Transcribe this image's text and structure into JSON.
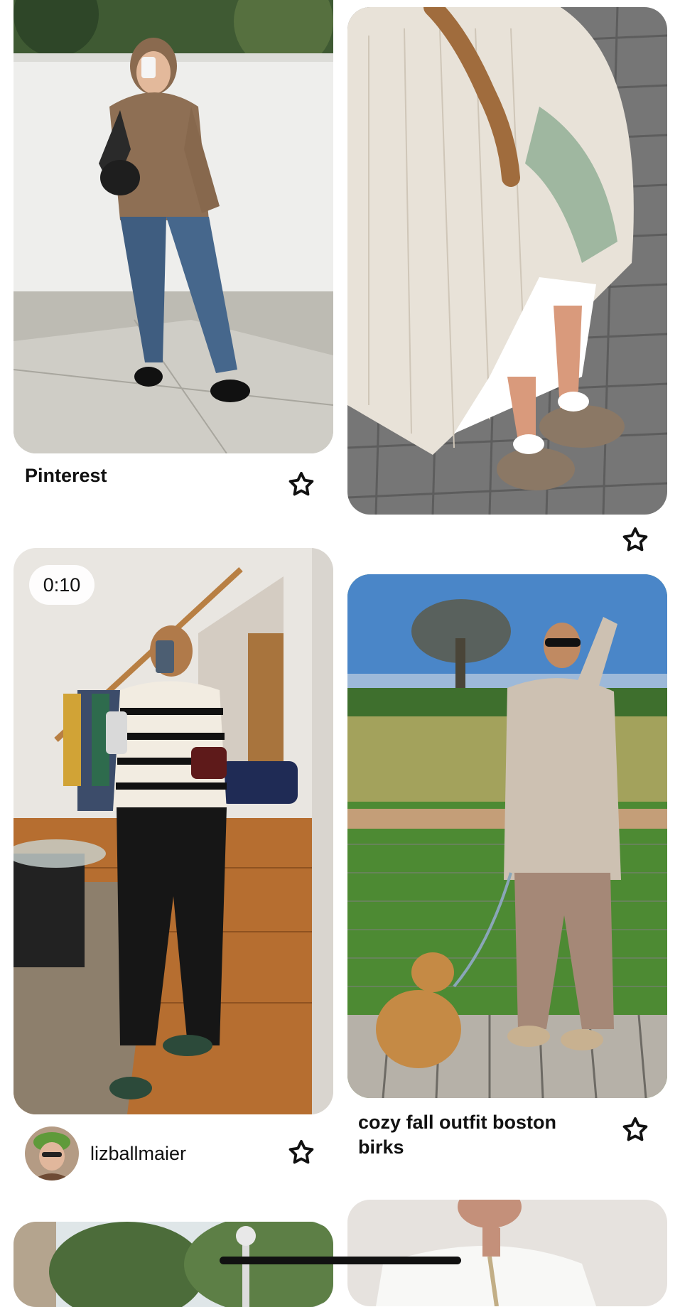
{
  "feed": {
    "pins": [
      {
        "title": "Pinterest",
        "media": "photo of woman holding coffee cup wearing brown knit sweater and jeans",
        "save_icon": "star-outline-icon"
      },
      {
        "title": "",
        "media": "close-up photo of oatmeal knit sweater over white slip dress and suede clogs",
        "save_icon": "star-outline-icon"
      },
      {
        "title": "",
        "duration": "0:10",
        "creator": "lizballmaier",
        "media": "video of woman taking mirror selfie in striped polo sweater and black trousers",
        "save_icon": "star-outline-icon"
      },
      {
        "title": "cozy fall outfit boston birks",
        "media": "photo of woman in grey sweater and taupe pants walking a dog on a boardwalk",
        "save_icon": "star-outline-icon"
      },
      {
        "title": "",
        "media": "partially visible photo of trees and lamp post"
      },
      {
        "title": "",
        "media": "partially visible photo of person in white sweater"
      }
    ]
  },
  "colors": {
    "background": "#ffffff",
    "text": "#111111",
    "badge_bg": "#ffffff"
  }
}
